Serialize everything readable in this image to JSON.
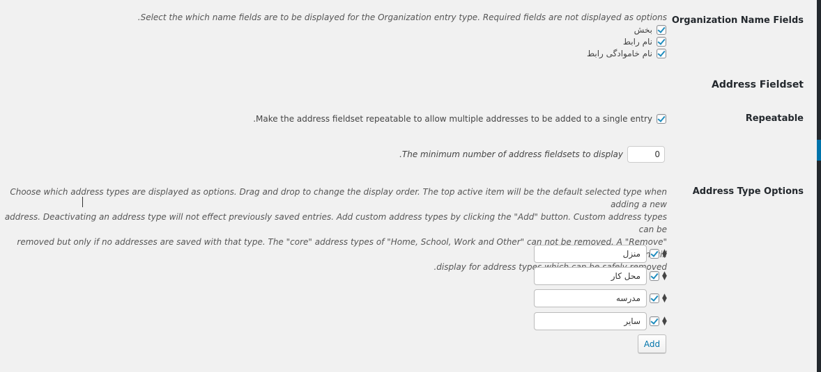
{
  "organization_name_fields": {
    "label": "Organization Name Fields",
    "description": ".Select the which name fields are to be displayed for the Organization entry type. Required fields are not displayed as options",
    "options": [
      {
        "label": "بخش",
        "checked": true
      },
      {
        "label": "نام رابط",
        "checked": true
      },
      {
        "label": "نام خاموادگی رابط",
        "checked": true
      }
    ]
  },
  "address_fieldset": {
    "title": "Address Fieldset",
    "repeatable": {
      "label": "Repeatable",
      "description": ".Make the address fieldset repeatable to allow multiple addresses to be added to a single entry",
      "checked": true
    },
    "minimum": {
      "value": "0",
      "description": ".The minimum number of address fieldsets to display"
    },
    "address_type_options": {
      "label": "Address Type Options",
      "description_lines": [
        "Choose which address types are displayed as options. Drag and drop to change the display order. The top active item will be the default selected type when adding a new",
        "address. Deactivating an address type will not effect previously saved entries. Add custom address types by clicking the \"Add\" button. Custom address types can be",
        "removed but only if no addresses are saved with that type. The \"core\" address types of \"Home, School, Work and Other\" can not be removed. A \"Remove\" button will",
        ".display for address types which can be safely removed"
      ],
      "types": [
        {
          "value": "منزل",
          "checked": true
        },
        {
          "value": "محل کار",
          "checked": true
        },
        {
          "value": "مدرسه",
          "checked": true
        },
        {
          "value": "سایر",
          "checked": true
        }
      ],
      "add_button": "Add"
    }
  },
  "icons": {
    "sort": "sort-arrows-icon",
    "check": "checkmark-icon"
  }
}
